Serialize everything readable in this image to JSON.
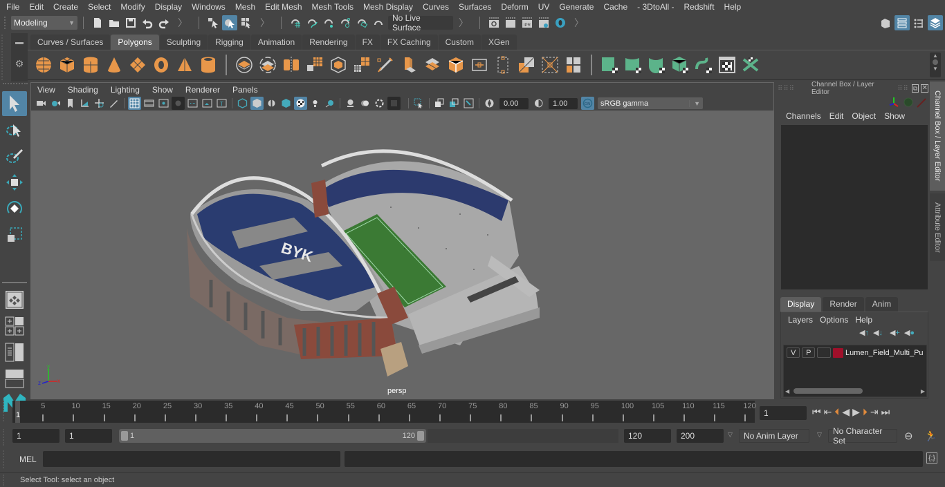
{
  "menubar": [
    "File",
    "Edit",
    "Create",
    "Select",
    "Modify",
    "Display",
    "Windows",
    "Mesh",
    "Edit Mesh",
    "Mesh Tools",
    "Mesh Display",
    "Curves",
    "Surfaces",
    "Deform",
    "UV",
    "Generate",
    "Cache",
    "- 3DtoAll -",
    "Redshift",
    "Help"
  ],
  "statusline": {
    "mode": "Modeling",
    "live_surface": "No Live Surface"
  },
  "shelf": {
    "tabs": [
      "Curves / Surfaces",
      "Polygons",
      "Sculpting",
      "Rigging",
      "Animation",
      "Rendering",
      "FX",
      "FX Caching",
      "Custom",
      "XGen"
    ],
    "active_tab": "Polygons",
    "icons": [
      "poly-sphere-icon",
      "poly-cube-icon",
      "poly-cylinder-icon",
      "poly-cone-icon",
      "poly-plane-icon",
      "poly-torus-icon",
      "poly-pyramid-icon",
      "poly-pipe-icon",
      "combine-icon",
      "separate-icon",
      "mirror-icon",
      "smooth-icon",
      "boolean-icon",
      "reduce-icon",
      "extrude-icon",
      "bevel-icon",
      "bridge-icon",
      "multicut-icon",
      "append-icon",
      "fill-hole-icon",
      "target-weld-icon",
      "edge-loop-icon",
      "insert-edge-loop-icon",
      "offset-edge-loop-icon",
      "triangulate-icon",
      "quadrangulate-icon",
      "planar-uv-icon",
      "automatic-uv-icon",
      "cylindrical-uv-icon",
      "spherical-uv-icon",
      "unfold-uv-icon",
      "uv-editor-icon",
      "layout-uv-icon"
    ]
  },
  "viewport": {
    "menus": [
      "View",
      "Shading",
      "Lighting",
      "Show",
      "Renderer",
      "Panels"
    ],
    "exposure": "0.00",
    "gamma": "1.00",
    "color_space": "sRGB gamma",
    "camera_label": "persp",
    "axis": {
      "x": "x",
      "y": "y",
      "z": "z"
    }
  },
  "channel_box": {
    "title": "Channel Box / Layer Editor",
    "menus": [
      "Channels",
      "Edit",
      "Object",
      "Show"
    ],
    "layer_tabs": [
      "Display",
      "Render",
      "Anim"
    ],
    "active_layer_tab": "Display",
    "layer_menus": [
      "Layers",
      "Options",
      "Help"
    ],
    "layers": [
      {
        "v": "V",
        "p": "P",
        "color": "#a0102a",
        "name": "Lumen_Field_Multi_Pu"
      }
    ]
  },
  "side_tabs": [
    "Channel Box / Layer Editor",
    "Attribute Editor"
  ],
  "timeline": {
    "ticks": [
      5,
      10,
      15,
      20,
      25,
      30,
      35,
      40,
      45,
      50,
      55,
      60,
      65,
      70,
      75,
      80,
      85,
      90,
      95,
      100,
      105,
      110,
      115,
      120
    ],
    "current_frame_marker": "1",
    "current_frame": "1"
  },
  "range": {
    "start": "1",
    "playback_start": "1",
    "slider_start": "1",
    "slider_end": "120",
    "playback_end": "120",
    "end": "200",
    "anim_layer": "No Anim Layer",
    "character_set": "No Character Set"
  },
  "command": {
    "label": "MEL",
    "input": ""
  },
  "helpline": "Select Tool: select an object"
}
